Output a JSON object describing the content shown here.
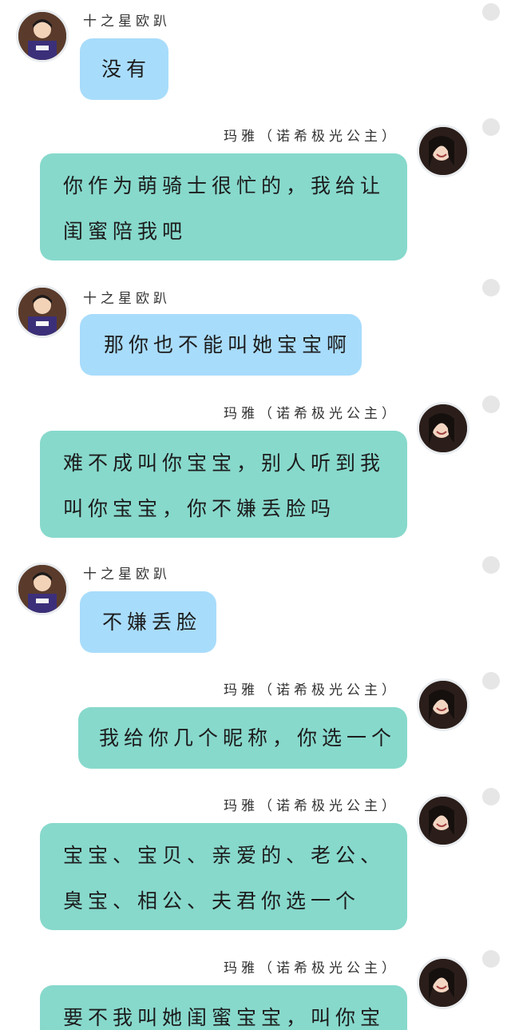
{
  "participants": {
    "left": {
      "name": "十之星欧趴"
    },
    "right": {
      "name": "玛雅（诺希极光公主）"
    }
  },
  "colors": {
    "left_bubble": "#a8dcfb",
    "right_bubble": "#87d9cc",
    "status_dot": "#e6e6e6"
  },
  "messages": [
    {
      "side": "left",
      "sender": "十之星欧趴",
      "lines": [
        "没有"
      ]
    },
    {
      "side": "right",
      "sender": "玛雅（诺希极光公主）",
      "lines": [
        "你作为萌骑士很忙的，我给让",
        "闺蜜陪我吧"
      ]
    },
    {
      "side": "left",
      "sender": "十之星欧趴",
      "lines": [
        "那你也不能叫她宝宝啊"
      ]
    },
    {
      "side": "right",
      "sender": "玛雅（诺希极光公主）",
      "lines": [
        "难不成叫你宝宝，别人听到我",
        "叫你宝宝，你不嫌丢脸吗"
      ]
    },
    {
      "side": "left",
      "sender": "十之星欧趴",
      "lines": [
        "不嫌丢脸"
      ]
    },
    {
      "side": "right",
      "sender": "玛雅（诺希极光公主）",
      "lines": [
        "我给你几个昵称，你选一个"
      ]
    },
    {
      "side": "right",
      "sender": "玛雅（诺希极光公主）",
      "lines": [
        "宝宝、宝贝、亲爱的、老公、",
        "臭宝、相公、夫君你选一个"
      ]
    },
    {
      "side": "right",
      "sender": "玛雅（诺希极光公主）",
      "lines": [
        "要不我叫她闺蜜宝宝，叫你宝"
      ]
    }
  ]
}
